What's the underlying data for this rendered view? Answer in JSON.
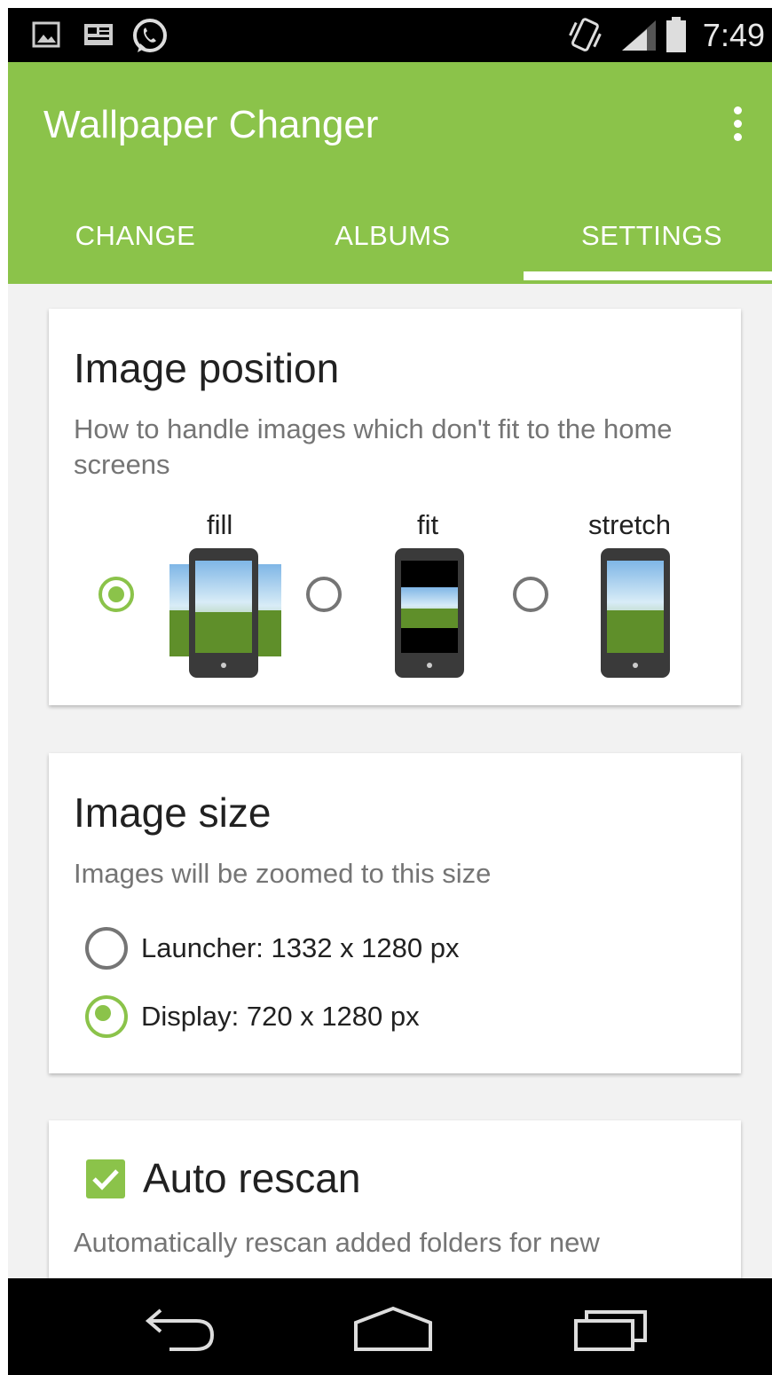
{
  "status_bar": {
    "time": "7:49",
    "icons": [
      "image-icon",
      "news-icon",
      "whatsapp-icon",
      "vibrate-icon",
      "signal-icon",
      "battery-icon"
    ]
  },
  "app_bar": {
    "title": "Wallpaper Changer",
    "menu_icon": "overflow-menu-icon",
    "color": "#8bc34a"
  },
  "tabs": [
    {
      "label": "CHANGE",
      "selected": false
    },
    {
      "label": "ALBUMS",
      "selected": false
    },
    {
      "label": "SETTINGS",
      "selected": true
    }
  ],
  "image_position": {
    "title": "Image position",
    "description": "How to handle images which don't fit to the home screens",
    "options": [
      {
        "label": "fill",
        "selected": true
      },
      {
        "label": "fit",
        "selected": false
      },
      {
        "label": "stretch",
        "selected": false
      }
    ]
  },
  "image_size": {
    "title": "Image size",
    "description": "Images will be zoomed to this size",
    "options": [
      {
        "label": "Launcher: 1332 x 1280 px",
        "selected": false
      },
      {
        "label": "Display: 720 x 1280 px",
        "selected": true
      }
    ]
  },
  "auto_rescan": {
    "title": "Auto rescan",
    "checked": true,
    "description": "Automatically rescan added folders for new"
  },
  "nav_bar": {
    "icons": [
      "back-icon",
      "home-icon",
      "recents-icon"
    ]
  },
  "colors": {
    "accent": "#8bc34a",
    "text_primary": "#212121",
    "text_secondary": "#757575"
  }
}
